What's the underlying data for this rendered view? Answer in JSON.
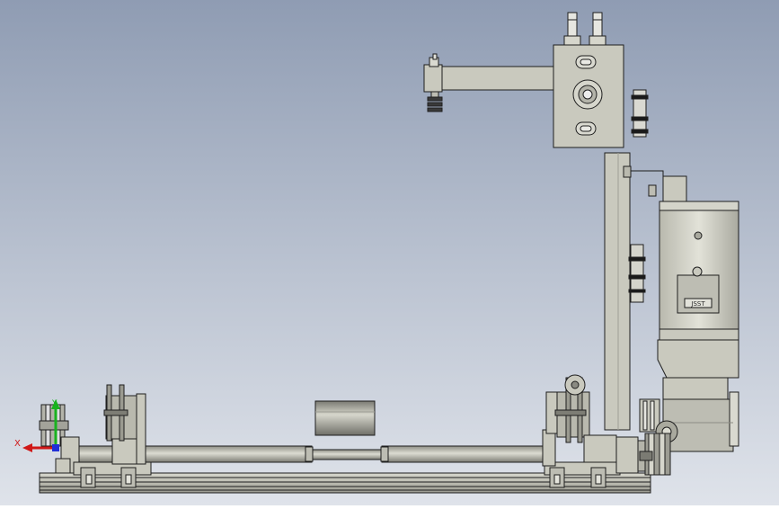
{
  "viewport": {
    "background_top": "#8f9cb3",
    "background_bottom": "#dfe3ea",
    "part_fill": "#c9c9be",
    "part_fill_dark": "#a9a99e",
    "edge_color": "#1e1e1e"
  },
  "motor": {
    "nameplate_text": "JSST"
  },
  "triad": {
    "x_label": "X",
    "y_label": "Y",
    "x_color": "#d01818",
    "y_color": "#19b21f",
    "z_color": "#2130d8"
  }
}
